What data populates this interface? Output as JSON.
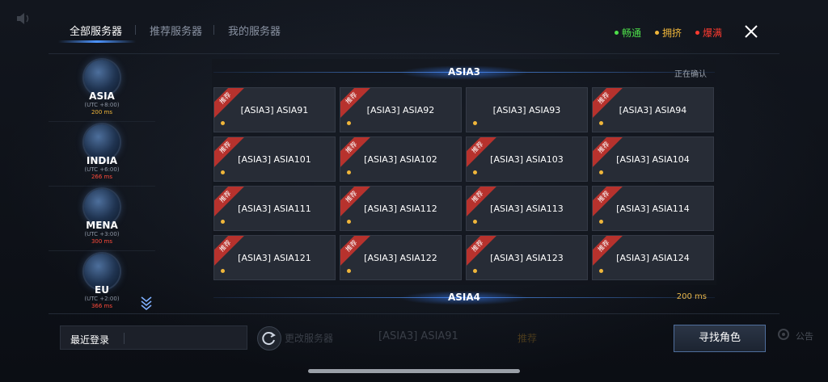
{
  "tabs": [
    {
      "label": "全部服务器",
      "active": true
    },
    {
      "label": "推荐服务器",
      "active": false
    },
    {
      "label": "我的服务器",
      "active": false
    }
  ],
  "legend": [
    {
      "label": "畅通",
      "color": "#4ee04a"
    },
    {
      "label": "拥挤",
      "color": "#f0b63a"
    },
    {
      "label": "爆满",
      "color": "#ff3b30"
    }
  ],
  "regions": [
    {
      "name": "ASIA",
      "utc": "(UTC +8:00)",
      "ping": "200 ms",
      "ping_color": "#f0b63a"
    },
    {
      "name": "INDIA",
      "utc": "(UTC +6:00)",
      "ping": "266 ms",
      "ping_color": "#ff4a3a"
    },
    {
      "name": "MENA",
      "utc": "(UTC +3:00)",
      "ping": "300 ms",
      "ping_color": "#ff4a3a"
    },
    {
      "name": "EU",
      "utc": "(UTC +2:00)",
      "ping": "366 ms",
      "ping_color": "#ff4a3a"
    }
  ],
  "groups": [
    {
      "title": "ASIA3",
      "status": "正在确认"
    },
    {
      "title": "ASIA4",
      "ping": "200 ms"
    }
  ],
  "recommend_label": "推荐",
  "servers": [
    {
      "name": "[ASIA3] ASIA91",
      "recommended": true
    },
    {
      "name": "[ASIA3] ASIA92",
      "recommended": true
    },
    {
      "name": "[ASIA3] ASIA93",
      "recommended": false
    },
    {
      "name": "[ASIA3] ASIA94",
      "recommended": true
    },
    {
      "name": "[ASIA3] ASIA101",
      "recommended": true
    },
    {
      "name": "[ASIA3] ASIA102",
      "recommended": true
    },
    {
      "name": "[ASIA3] ASIA103",
      "recommended": true
    },
    {
      "name": "[ASIA3] ASIA104",
      "recommended": true
    },
    {
      "name": "[ASIA3] ASIA111",
      "recommended": true
    },
    {
      "name": "[ASIA3] ASIA112",
      "recommended": true
    },
    {
      "name": "[ASIA3] ASIA113",
      "recommended": true
    },
    {
      "name": "[ASIA3] ASIA114",
      "recommended": true
    },
    {
      "name": "[ASIA3] ASIA121",
      "recommended": true
    },
    {
      "name": "[ASIA3] ASIA122",
      "recommended": true
    },
    {
      "name": "[ASIA3] ASIA123",
      "recommended": true
    },
    {
      "name": "[ASIA3] ASIA124",
      "recommended": true
    }
  ],
  "bottom": {
    "recent_label": "最近登录",
    "ghost_change": "更改服务器",
    "ghost_server": "[ASIA3] ASIA91",
    "ghost_tag": "推荐",
    "ghost_notice": "公告",
    "find_button": "寻找角色"
  }
}
